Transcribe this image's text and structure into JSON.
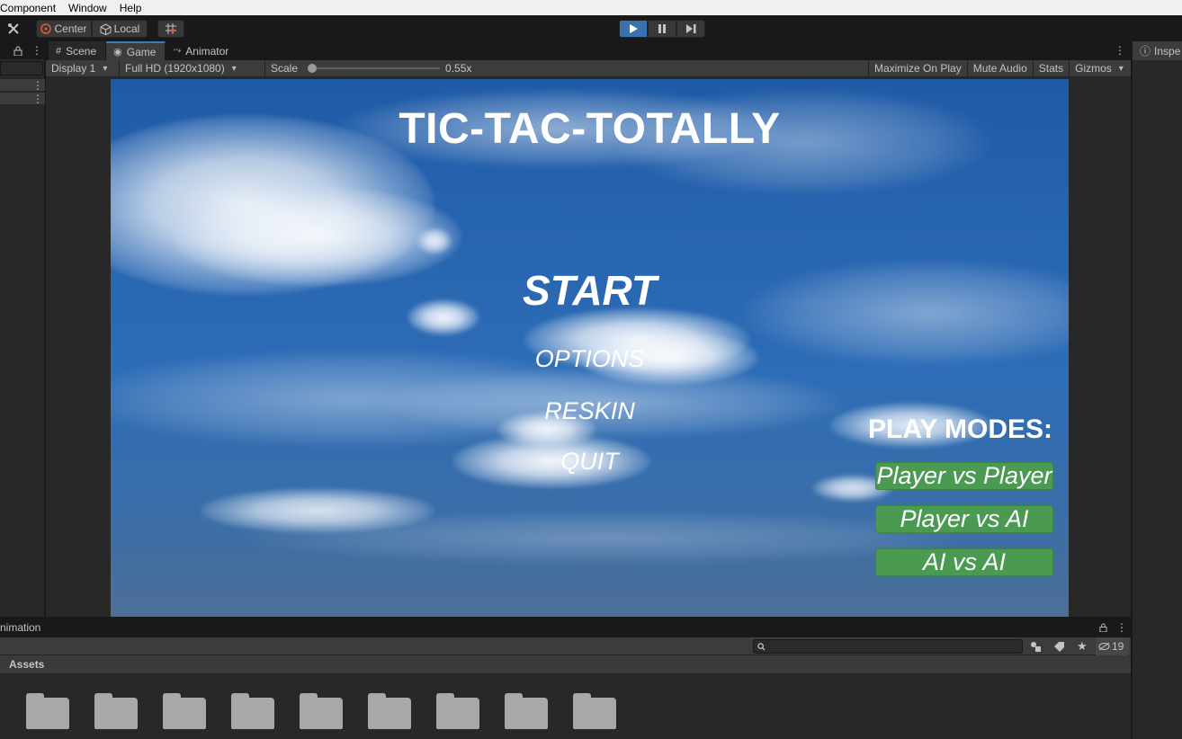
{
  "menubar": {
    "items": [
      "Component",
      "Window",
      "Help"
    ]
  },
  "toolbar": {
    "tools_icon": "tools-icon",
    "center_label": "Center",
    "local_label": "Local",
    "grid_snap_icon": "grid-snap-icon",
    "play_icon": "▶",
    "pause_icon": "❚❚",
    "step_icon": "▶|"
  },
  "left_panel": {
    "lock_icon": "lock-icon",
    "menu_icon": "⋮"
  },
  "game_panel": {
    "tabs": [
      {
        "label": "Scene",
        "icon": "#"
      },
      {
        "label": "Game",
        "icon": "◉"
      },
      {
        "label": "Animator",
        "icon": "⤳"
      }
    ],
    "display": "Display 1",
    "resolution": "Full HD (1920x1080)",
    "scale_label": "Scale",
    "scale_value": "0.55x",
    "scale_fraction": 0.0,
    "maximize": "Maximize On Play",
    "mute": "Mute Audio",
    "stats": "Stats",
    "gizmos": "Gizmos"
  },
  "game": {
    "title": "TIC-TAC-TOTALLY",
    "start": "START",
    "options": "OPTIONS",
    "reskin": "RESKIN",
    "quit": "QUIT",
    "modes_title": "PLAY MODES:",
    "modes": [
      "Player vs Player",
      "Player vs AI",
      "AI vs AI"
    ],
    "button_color": "#4a9a52"
  },
  "bottom_panel": {
    "tab_label": "nimation",
    "hidden_count": "19",
    "assets_label": "Assets",
    "folder_count": 9
  },
  "inspector": {
    "tab_label": "Inspe",
    "icon": "ⓘ"
  }
}
